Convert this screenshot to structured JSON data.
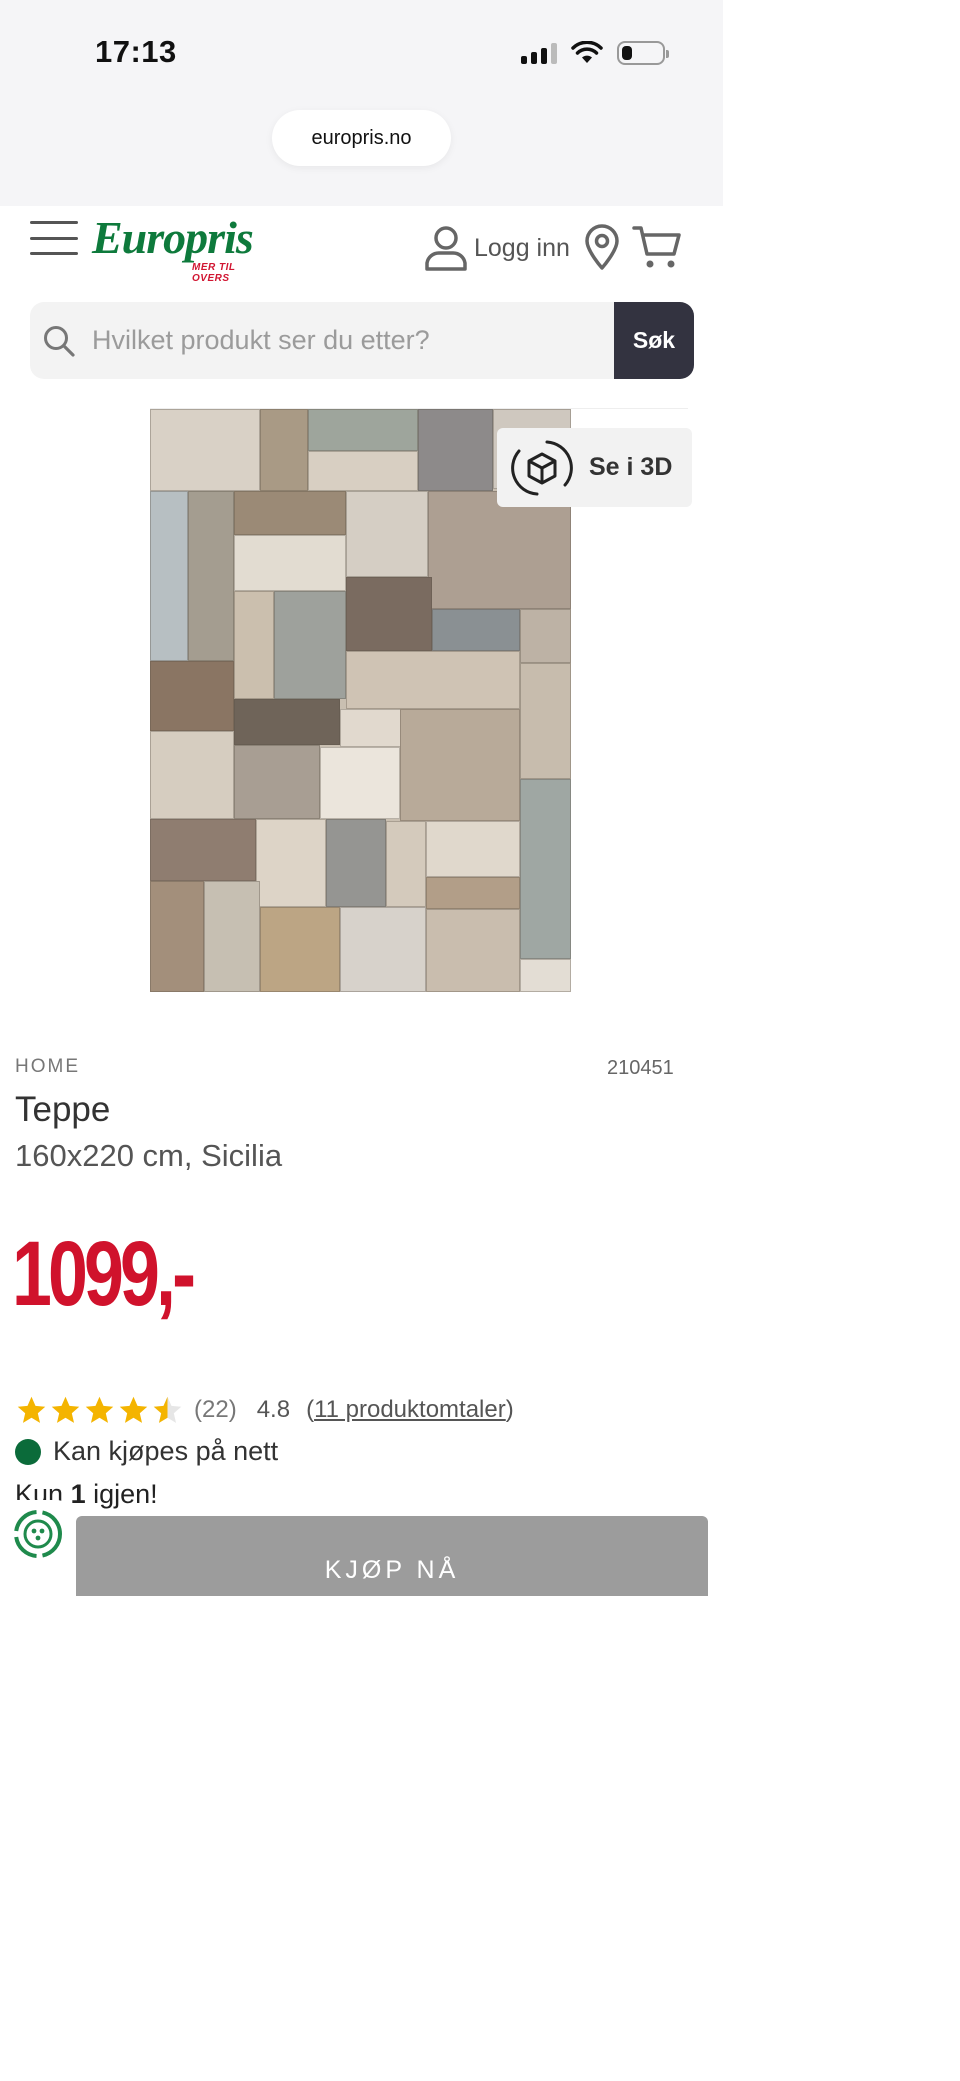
{
  "status_bar": {
    "time": "17:13",
    "battery_level": 0.25
  },
  "browser": {
    "url": "europris.no"
  },
  "header": {
    "logo_text": "Europris",
    "logo_tagline": "MER TIL OVERS",
    "login_label": "Logg inn",
    "colors": {
      "brand_green": "#0e7a3c",
      "brand_red": "#d11531"
    }
  },
  "search": {
    "placeholder": "Hvilket produkt ser du etter?",
    "button_label": "Søk"
  },
  "product": {
    "view_3d_label": "Se i 3D",
    "category": "HOME",
    "sku": "210451",
    "name": "Teppe",
    "variant": "160x220 cm, Sicilia",
    "price": "1099,-",
    "price_color": "#d0122c",
    "rating": {
      "stars": 4.5,
      "review_count": "(22)",
      "average": "4.8",
      "reviews_link_open": "(",
      "reviews_link_text": "11 produktomtaler",
      "reviews_link_close": ")"
    },
    "availability_label": "Kan kjøpes på nett",
    "stock_prefix": "Kun",
    "stock_count": "1",
    "stock_suffix": "igjen!",
    "buy_button_label": "KJØP NÅ"
  },
  "icons": [
    "menu-icon",
    "user-icon",
    "location-pin-icon",
    "cart-icon",
    "search-icon",
    "3d-cube-icon",
    "star-icon",
    "recycle-icon"
  ]
}
